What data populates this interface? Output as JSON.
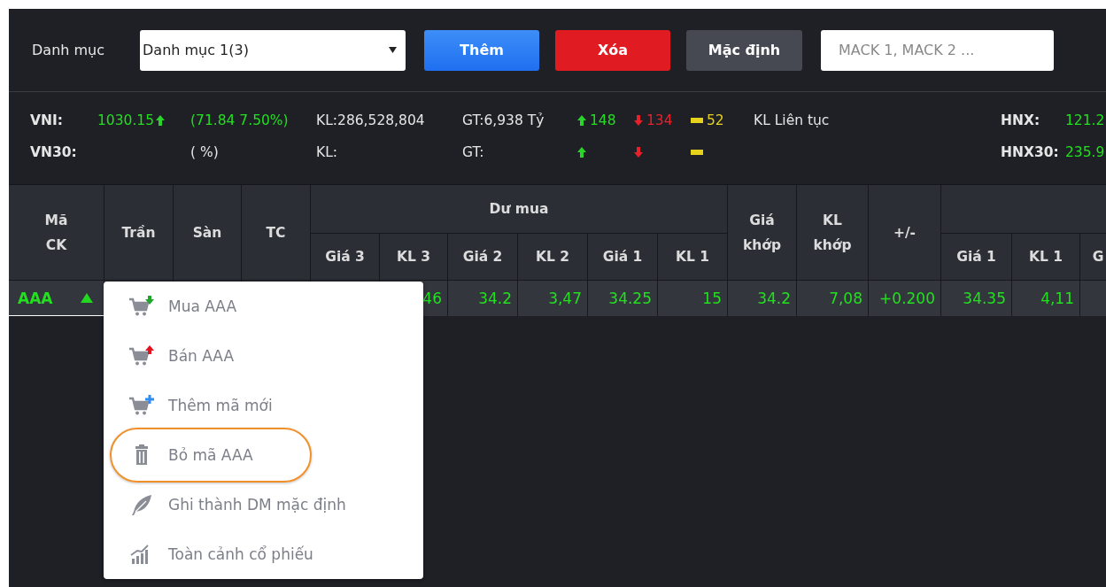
{
  "toolbar": {
    "label": "Danh mục",
    "select": {
      "value": "Danh mục 1(3)"
    },
    "buttons": [
      {
        "label": "Thêm",
        "kind": "add"
      },
      {
        "label": "Xóa",
        "kind": "delete"
      },
      {
        "label": "Mặc định",
        "kind": "default"
      }
    ],
    "search": {
      "placeholder": "MACK 1, MACK 2 ..."
    }
  },
  "indices": [
    {
      "name": "VNI:",
      "value": "1030.15",
      "up": true,
      "change": "(71.84 7.50%)",
      "volume": "KL:286,528,804",
      "turnover": "GT:6,938 Tỷ",
      "advances": "148",
      "declines": "134",
      "unchanged": "52",
      "session": "KL Liên tục",
      "other_name": "HNX:",
      "other_value": "121.2"
    },
    {
      "name": "VN30:",
      "up": false,
      "change": "( %)",
      "volume": "KL:",
      "turnover": "GT:",
      "other_name": "HNX30:",
      "other_value": "235.9"
    }
  ],
  "table": {
    "groups": [
      {
        "kind": "labeled",
        "label": "Dư mua"
      },
      {
        "kind": "blank"
      }
    ],
    "columns": [
      {
        "label": "Mã CK",
        "grouped": false
      },
      {
        "label": "Trần",
        "grouped": false
      },
      {
        "label": "Sàn",
        "grouped": false
      },
      {
        "label": "TC",
        "grouped": false
      },
      {
        "label": "Giá 3",
        "grouped": true
      },
      {
        "label": "KL 3",
        "grouped": true
      },
      {
        "label": "Giá 2",
        "grouped": true
      },
      {
        "label": "KL 2",
        "grouped": true
      },
      {
        "label": "Giá 1",
        "grouped": true
      },
      {
        "label": "KL 1",
        "grouped": true
      },
      {
        "label": "Giá khớp",
        "grouped": false
      },
      {
        "label": "KL khớp",
        "grouped": false
      },
      {
        "label": "+/-",
        "grouped": false
      },
      {
        "label": "Giá 1",
        "grouped": true
      },
      {
        "label": "KL 1",
        "grouped": true
      },
      {
        "label": "G",
        "grouped": true
      }
    ],
    "rows": [
      {
        "up": true,
        "cells": [
          "AAA",
          "",
          "",
          "",
          "",
          "46",
          "34.2",
          "3,47",
          "34.25",
          "15",
          "34.2",
          "7,08",
          "+0.200",
          "34.35",
          "4,11",
          ""
        ]
      }
    ]
  },
  "context_menu": {
    "items": [
      {
        "label": "Mua AAA",
        "kind": "buy",
        "highlighted": false
      },
      {
        "label": "Bán AAA",
        "kind": "sell",
        "highlighted": false
      },
      {
        "label": "Thêm mã mới",
        "kind": "add",
        "highlighted": false
      },
      {
        "label": "Bỏ mã AAA",
        "kind": "remove",
        "highlighted": true
      },
      {
        "label": "Ghi thành DM mặc định",
        "kind": "save",
        "highlighted": false
      },
      {
        "label": "Toàn cảnh cổ phiếu",
        "kind": "overview",
        "highlighted": false
      }
    ]
  }
}
